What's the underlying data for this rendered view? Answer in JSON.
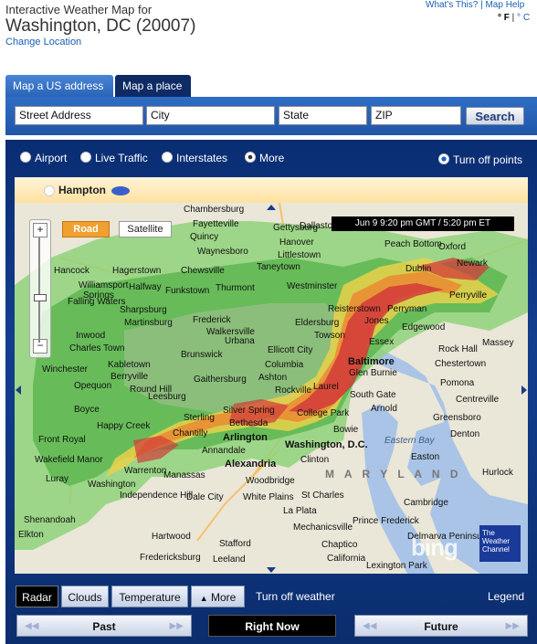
{
  "header": {
    "title": "Interactive Weather Map for",
    "location": "Washington, DC (20007)",
    "change_location": "Change Location",
    "whats_this": "What's This?",
    "map_help": "Map Help",
    "unit_f": "° F",
    "unit_c": "° C"
  },
  "tabs": [
    {
      "label": "Map a US address",
      "active": true
    },
    {
      "label": "Map a place",
      "active": false
    }
  ],
  "search": {
    "street": "Street Address",
    "city": "City",
    "state": "State",
    "zip": "ZIP",
    "button": "Search"
  },
  "layers": [
    {
      "label": "Airport",
      "selected": false
    },
    {
      "label": "Live Traffic",
      "selected": false
    },
    {
      "label": "Interstates",
      "selected": false
    },
    {
      "label": "More",
      "selected": false
    }
  ],
  "turn_off_points": "Turn off points",
  "points_bar": {
    "label": "Hampton"
  },
  "map": {
    "road": "Road",
    "satellite": "Satellite",
    "timestamp": "Jun 9  9:20 pm GMT / 5:20 pm ET",
    "bing": "bing",
    "twc": "The Weather Channel",
    "zoom_in": "+",
    "zoom_out": "−",
    "places": {
      "chambersburg": "Chambersburg",
      "fayetteville": "Fayetteville",
      "quincy": "Quincy",
      "waynesboro": "Waynesboro",
      "gettysburg": "Gettysburg",
      "hanover": "Hanover",
      "littlestown": "Littlestown",
      "taneytown": "Taneytown",
      "dallastown": "Dallastown",
      "peach_bottom": "Peach Bottom",
      "oxford": "Oxford",
      "newark": "Newark",
      "dublin": "Dublin",
      "hancock": "Hancock",
      "hagerstown": "Hagerstown",
      "chewsville": "Chewsville",
      "williamsport": "Williamsport",
      "halfway": "Halfway",
      "funkstown": "Funkstown",
      "thurmont": "Thurmont",
      "westminster": "Westminster",
      "reisterstown": "Reisterstown",
      "perryman": "Perryman",
      "perryville": "Perryville",
      "falling_waters": "Falling Waters",
      "springs": "Springs",
      "sharpsburg": "Sharpsburg",
      "frederick": "Frederick",
      "eldersburg": "Eldersburg",
      "jones": "Jones",
      "edgewood": "Edgewood",
      "massey": "Massey",
      "martinsburg": "Martinsburg",
      "walkersville": "Walkersville",
      "towson": "Towson",
      "essex": "Essex",
      "rock_hall": "Rock Hall",
      "inwood": "Inwood",
      "charles_town": "Charles Town",
      "brunswick": "Brunswick",
      "urbana": "Urbana",
      "ellicott_city": "Ellicott City",
      "baltimore": "Baltimore",
      "chestertown": "Chestertown",
      "winchester": "Winchester",
      "kabletown": "Kabletown",
      "berryville": "Berryville",
      "columbia": "Columbia",
      "glen_burnie": "Glen Burnie",
      "opequon": "Opequon",
      "round_hill": "Round Hill",
      "gaithersburg": "Gaithersburg",
      "ashton": "Ashton",
      "laurel": "Laurel",
      "annapolis": "Annapolis",
      "pomona": "Pomona",
      "centreville": "Centreville",
      "leesburg": "Leesburg",
      "rockville": "Rockville",
      "south_gate": "South Gate",
      "arnold": "Arnold",
      "greensboro": "Greensboro",
      "boyce": "Boyce",
      "happy_creek": "Happy Creek",
      "sterling": "Sterling",
      "silver_spring": "Silver Spring",
      "college_park": "College Park",
      "bowie": "Bowie",
      "denton": "Denton",
      "front_royal": "Front Royal",
      "chantilly": "Chantilly",
      "bethesda": "Bethesda",
      "arlington": "Arlington",
      "washington": "Washington, D.C.",
      "eastern_bay": "Eastern Bay",
      "easton": "Easton",
      "wakefield_manor": "Wakefield Manor",
      "annandale": "Annandale",
      "alexandria": "Alexandria",
      "clinton": "Clinton",
      "maryland": "M A R Y L A N D",
      "hurlock": "Hurlock",
      "luray": "Luray",
      "warrenton": "Warrenton",
      "manassas": "Manassas",
      "woodbridge": "Woodbridge",
      "washington_va": "Washington",
      "independence_hill": "Independence Hill",
      "dale_city": "Dale City",
      "white_plains": "White Plains",
      "st_charles": "St Charles",
      "cambridge": "Cambridge",
      "shenandoah": "Shenandoah",
      "la_plata": "La Plata",
      "prince_frederick": "Prince Frederick",
      "mechanicsville": "Mechanicsville",
      "elkton": "Elkton",
      "hartwood": "Hartwood",
      "stafford": "Stafford",
      "chaptico": "Chaptico",
      "fredericksburg": "Fredericksburg",
      "leeland": "Leeland",
      "california": "California",
      "delmarva": "Delmarva Peninsula",
      "lexington_park": "Lexington Park"
    }
  },
  "weather_buttons": {
    "radar": "Radar",
    "clouds": "Clouds",
    "temperature": "Temperature",
    "more": "More",
    "turn_off": "Turn off weather",
    "legend": "Legend"
  },
  "time_buttons": {
    "past": "Past",
    "now": "Right Now",
    "future": "Future"
  },
  "colors": {
    "panel_blue": "#133e8f",
    "tab_blue": "#2a64b8",
    "radar_green": "#5ec45a",
    "radar_red": "#d8363a",
    "road_orange": "#f0a030"
  }
}
